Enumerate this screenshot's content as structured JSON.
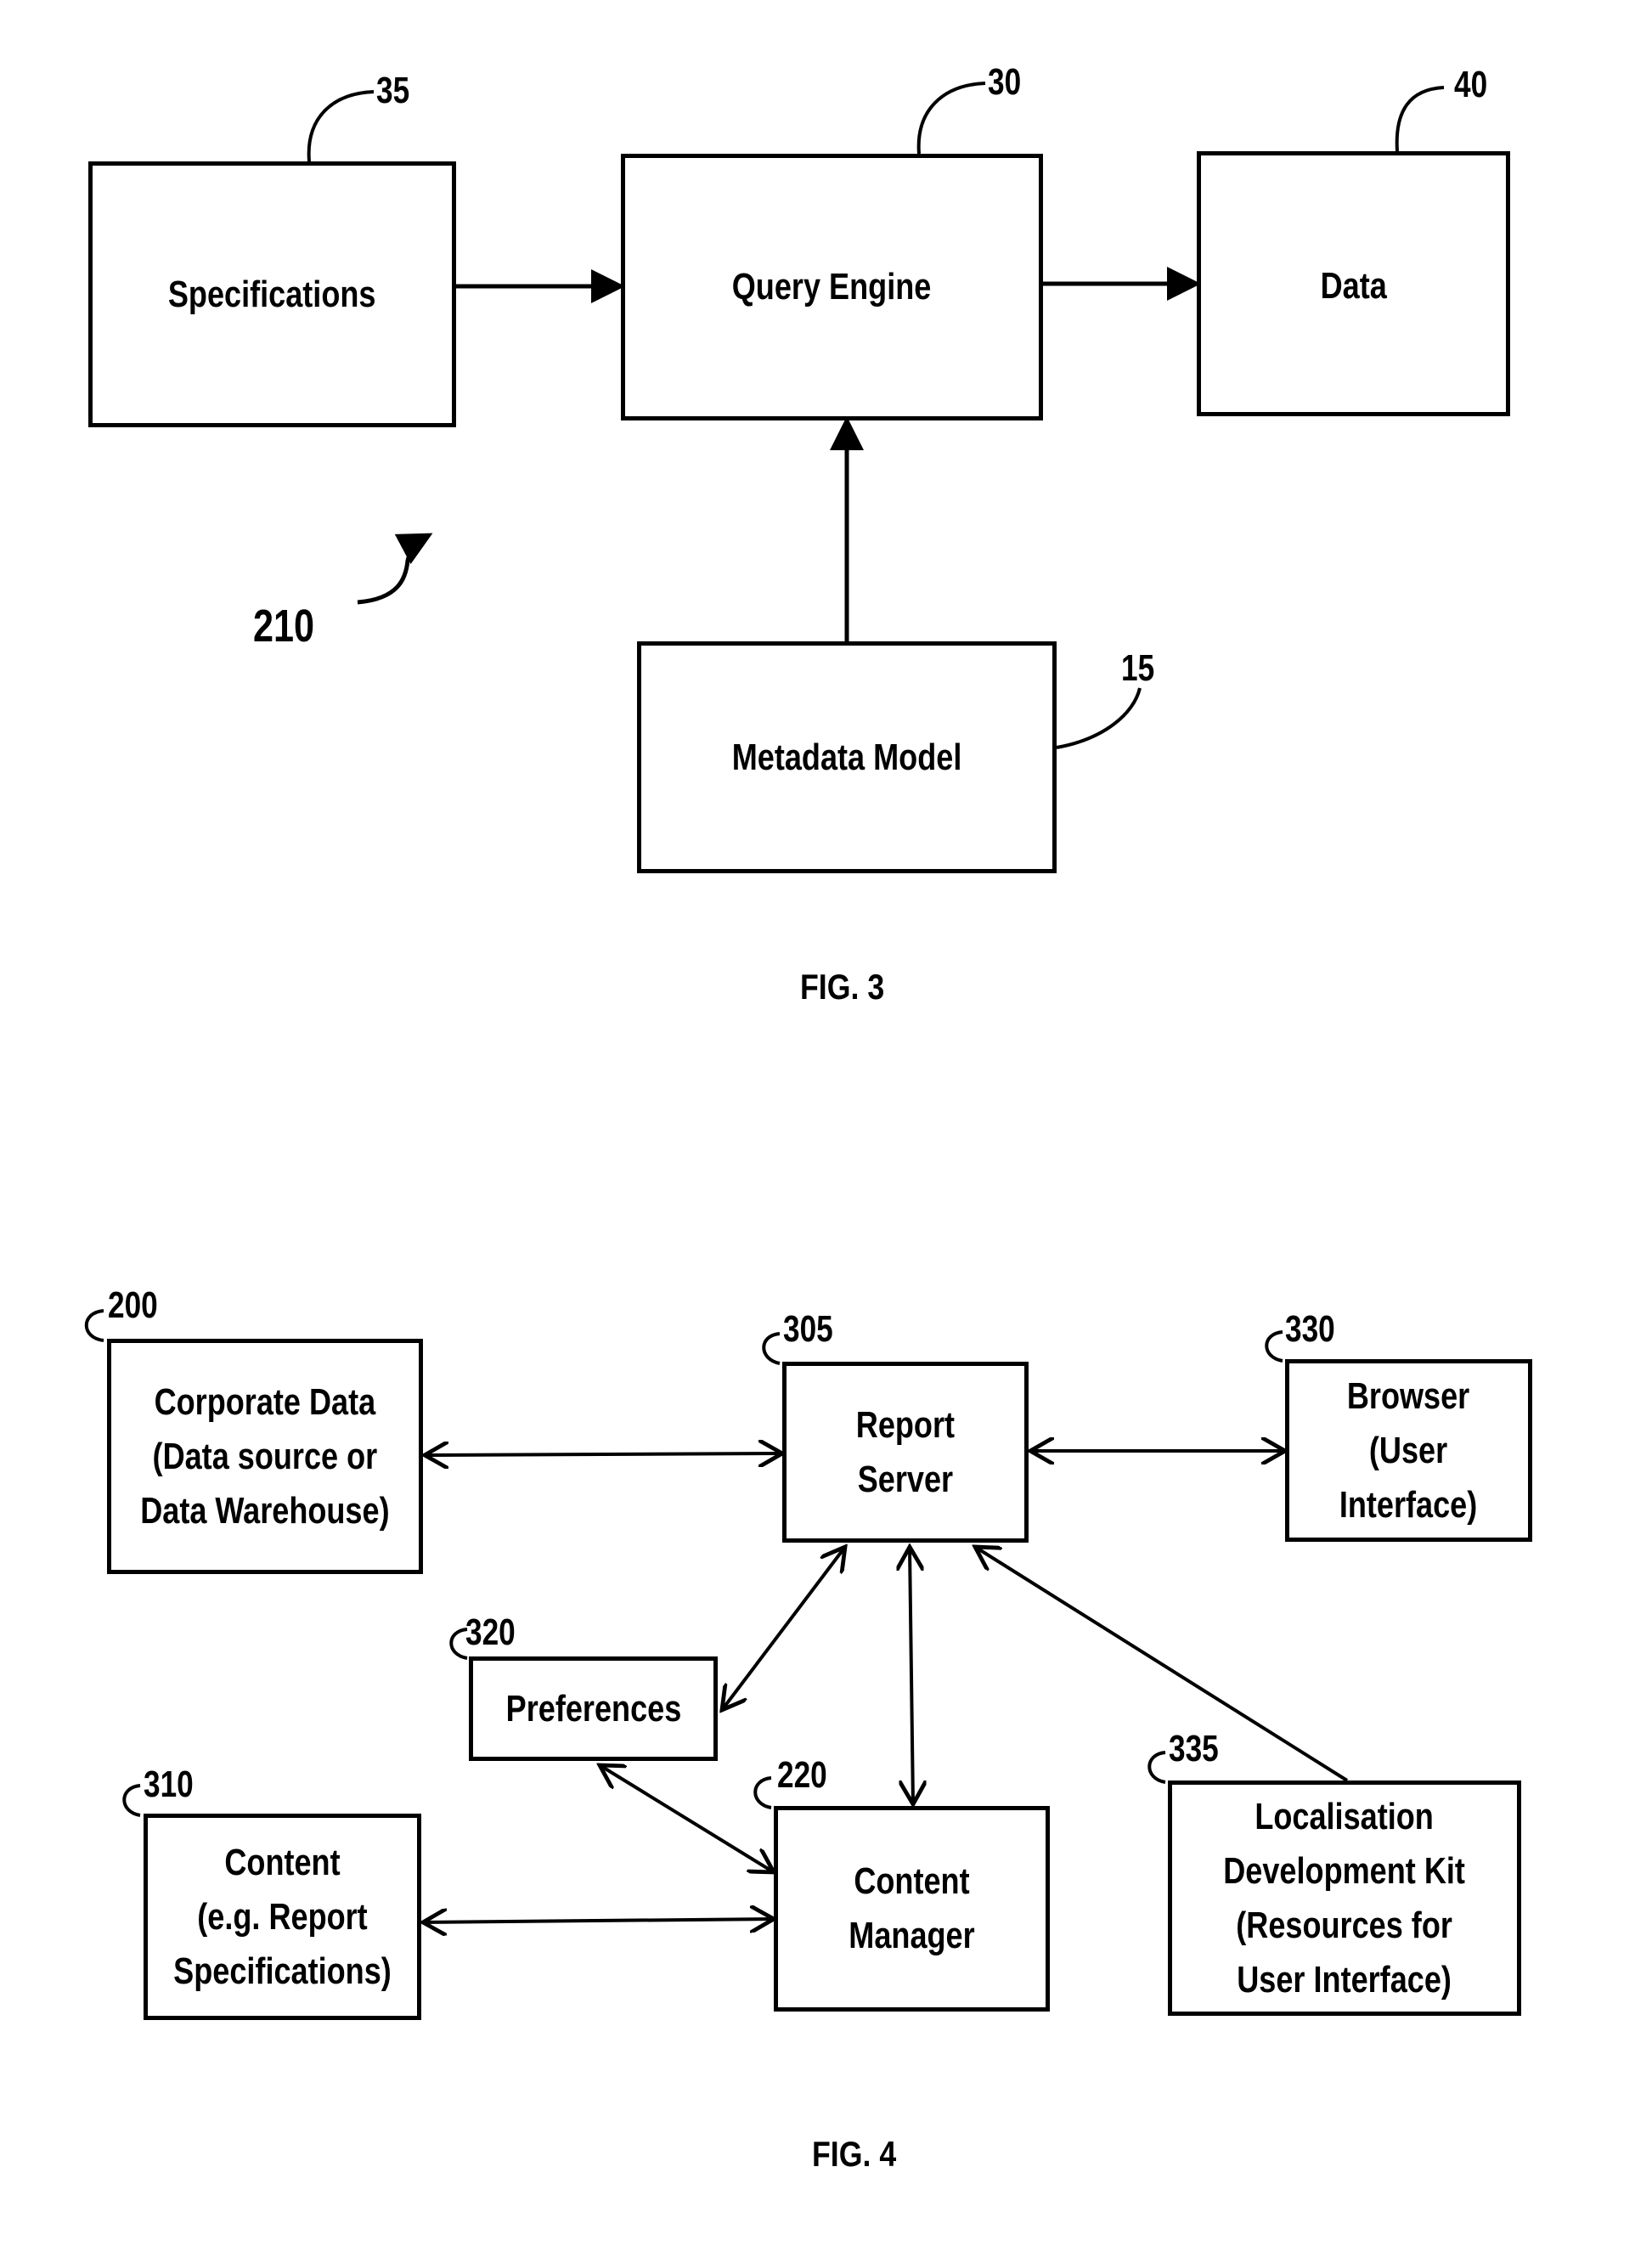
{
  "fig3": {
    "caption": "FIG. 3",
    "figure_ref": "210",
    "nodes": {
      "specifications": {
        "label": "Specifications",
        "ref": "35"
      },
      "query_engine": {
        "label": "Query Engine",
        "ref": "30"
      },
      "data": {
        "label": "Data",
        "ref": "40"
      },
      "metadata_model": {
        "label": "Metadata Model",
        "ref": "15"
      }
    },
    "edges": [
      {
        "from": "Specifications",
        "to": "Query Engine",
        "direction": "forward"
      },
      {
        "from": "Query Engine",
        "to": "Data",
        "direction": "forward"
      },
      {
        "from": "Metadata Model",
        "to": "Query Engine",
        "direction": "forward"
      }
    ]
  },
  "fig4": {
    "caption": "FIG. 4",
    "nodes": {
      "corporate_data": {
        "label": "Corporate Data\n(Data source or\nData Warehouse)",
        "ref": "200"
      },
      "report_server": {
        "label": "Report\nServer",
        "ref": "305"
      },
      "browser": {
        "label": "Browser\n(User\nInterface)",
        "ref": "330"
      },
      "preferences": {
        "label": "Preferences",
        "ref": "320"
      },
      "content": {
        "label": "Content\n(e.g. Report\nSpecifications)",
        "ref": "310"
      },
      "content_manager": {
        "label": "Content\nManager",
        "ref": "220"
      },
      "localisation": {
        "label": "Localisation\nDevelopment Kit\n(Resources for\nUser Interface)",
        "ref": "335"
      }
    },
    "edges": [
      {
        "from": "Corporate Data",
        "to": "Report Server",
        "direction": "both"
      },
      {
        "from": "Report Server",
        "to": "Browser",
        "direction": "both"
      },
      {
        "from": "Report Server",
        "to": "Preferences",
        "direction": "both"
      },
      {
        "from": "Report Server",
        "to": "Content Manager",
        "direction": "both"
      },
      {
        "from": "Localisation Development Kit",
        "to": "Report Server",
        "direction": "forward"
      },
      {
        "from": "Preferences",
        "to": "Content Manager",
        "direction": "both"
      },
      {
        "from": "Content",
        "to": "Content Manager",
        "direction": "both"
      }
    ]
  }
}
